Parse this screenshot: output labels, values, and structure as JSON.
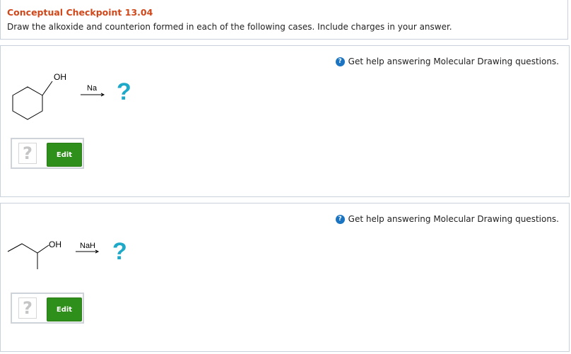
{
  "header": {
    "title": "Conceptual Checkpoint 13.04",
    "instructions": "Draw the alkoxide and counterion formed in each of the following cases. Include charges in your answer."
  },
  "questions": [
    {
      "help_text": "Get help answering Molecular Drawing questions.",
      "substituent_label": "OH",
      "reagent": "Na",
      "product_placeholder": "?",
      "answer_placeholder": "?",
      "edit_label": "Edit"
    },
    {
      "help_text": "Get help answering Molecular Drawing questions.",
      "substituent_label": "OH",
      "reagent": "NaH",
      "product_placeholder": "?",
      "answer_placeholder": "?",
      "edit_label": "Edit"
    }
  ],
  "colors": {
    "title": "#d0471a",
    "product_question_mark": "#1ea9c9",
    "edit_button": "#2f8f1b",
    "help_icon": "#1a74c1",
    "panel_border": "#c9d2dc"
  },
  "icons": {
    "help": "question-circle-icon"
  }
}
